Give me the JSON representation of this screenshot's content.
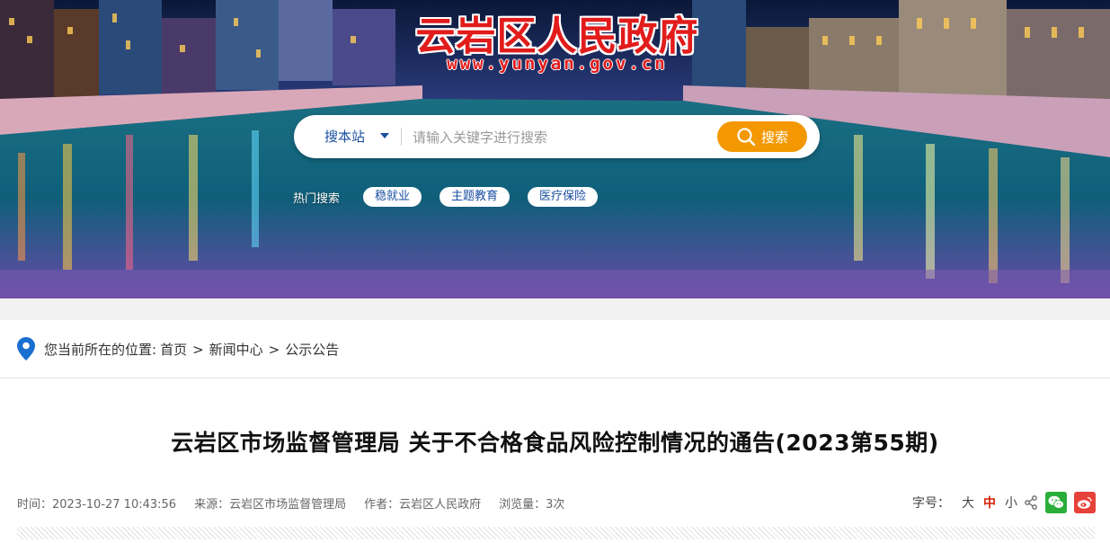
{
  "header": {
    "site_title": "云岩区人民政府",
    "site_url": "www.yunyan.gov.cn",
    "brand_color": "#e21b1b"
  },
  "search": {
    "scope_label": "搜本站",
    "placeholder": "请输入关键字进行搜索",
    "button_label": "搜索",
    "button_color": "#f39800",
    "hot_label": "热门搜索",
    "hot_tags": [
      "稳就业",
      "主题教育",
      "医疗保险"
    ]
  },
  "breadcrumb": {
    "prefix": "您当前所在的位置:",
    "items": [
      "首页",
      "新闻中心",
      "公示公告"
    ],
    "separator": ">"
  },
  "article": {
    "title": "云岩区市场监督管理局 关于不合格食品风险控制情况的通告(2023第55期)",
    "time": "时间：2023-10-27 10:43:56",
    "source": "来源：云岩区市场监督管理局",
    "author": "作者：云岩区人民政府",
    "views": "浏览量：3次"
  },
  "tools": {
    "font_size_label": "字号：",
    "large": "大",
    "medium": "中",
    "small": "小",
    "active_color": "#d81e06",
    "share_icons": [
      "share-icon",
      "wechat-icon",
      "weibo-icon"
    ]
  }
}
